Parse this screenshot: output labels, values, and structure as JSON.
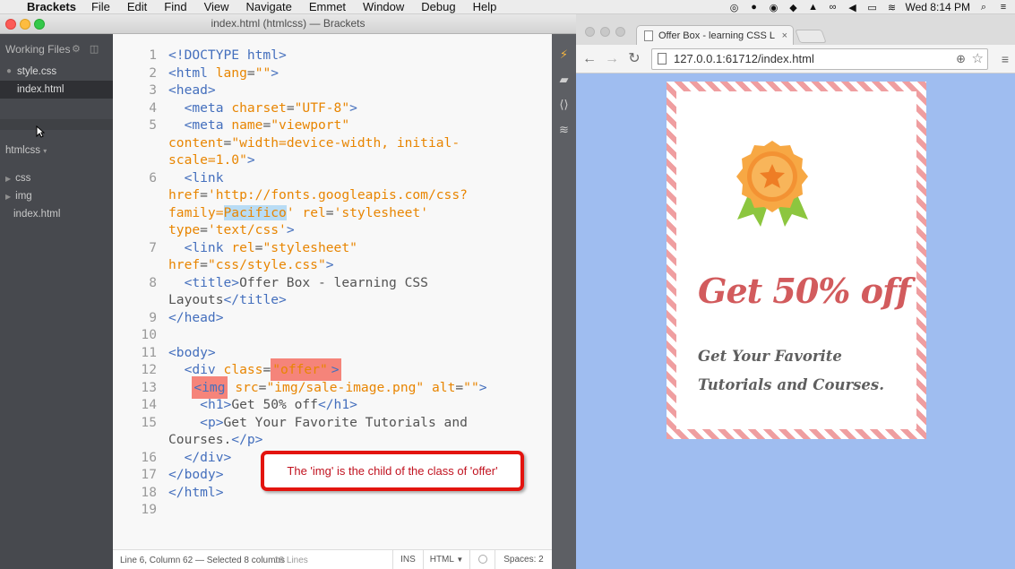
{
  "menubar": {
    "app": "Brackets",
    "items": [
      "File",
      "Edit",
      "Find",
      "View",
      "Navigate",
      "Emmet",
      "Window",
      "Debug",
      "Help"
    ],
    "clock": "Wed 8:14 PM"
  },
  "brackets": {
    "window_title": "index.html (htmlcss) — Brackets",
    "sidebar": {
      "working_files_label": "Working Files",
      "working_files": [
        "style.css",
        "index.html"
      ],
      "project_label": "htmlcss",
      "tree": [
        "css",
        "img",
        "index.html"
      ]
    },
    "code_lines": [
      {
        "n": "1",
        "html": "<span class='tag'>&lt;!DOCTYPE html&gt;</span>"
      },
      {
        "n": "2",
        "html": "<span class='tag'>&lt;html</span> <span class='attr'>lang</span>=<span class='str'>\"\"</span><span class='tag'>&gt;</span>"
      },
      {
        "n": "3",
        "html": "<span class='tag'>&lt;head&gt;</span>"
      },
      {
        "n": "4",
        "html": "  <span class='tag'>&lt;meta</span> <span class='attr'>charset</span>=<span class='str'>\"UTF-8\"</span><span class='tag'>&gt;</span>"
      },
      {
        "n": "5",
        "html": "  <span class='tag'>&lt;meta</span> <span class='attr'>name</span>=<span class='str'>\"viewport\"</span>"
      },
      {
        "n": "",
        "html": "<span class='attr'>content</span>=<span class='str'>\"width=device-width, initial-</span>"
      },
      {
        "n": "",
        "html": "<span class='str'>scale=1.0\"</span><span class='tag'>&gt;</span>"
      },
      {
        "n": "6",
        "html": "  <span class='tag'>&lt;link</span>"
      },
      {
        "n": "",
        "html": "<span class='attr'>href</span>=<span class='str'>'http://fonts.googleapis.com/css?</span>"
      },
      {
        "n": "",
        "html": "<span class='str'>family=<span class='hl-word'>Pacifico</span>'</span> <span class='attr'>rel</span>=<span class='str'>'stylesheet'</span>"
      },
      {
        "n": "",
        "html": "<span class='attr'>type</span>=<span class='str'>'text/css'</span><span class='tag'>&gt;</span>"
      },
      {
        "n": "7",
        "html": "  <span class='tag'>&lt;link</span> <span class='attr'>rel</span>=<span class='str'>\"stylesheet\"</span>"
      },
      {
        "n": "",
        "html": "<span class='attr'>href</span>=<span class='str'>\"css/style.css\"</span><span class='tag'>&gt;</span>"
      },
      {
        "n": "8",
        "html": "  <span class='tag'>&lt;title&gt;</span><span class='tx'>Offer Box - learning CSS</span>"
      },
      {
        "n": "",
        "html": "<span class='tx'>Layouts</span><span class='tag'>&lt;/title&gt;</span>"
      },
      {
        "n": "9",
        "html": "<span class='tag'>&lt;/head&gt;</span>"
      },
      {
        "n": "10",
        "html": ""
      },
      {
        "n": "11",
        "html": "<span class='tag'>&lt;body&gt;</span>"
      },
      {
        "n": "12",
        "html": "  <span class='tag'>&lt;div</span> <span class='attr'>class</span>=<span class='str hl-red2'>\"offer\"</span><span class='tag hl-red2'>&gt;</span>"
      },
      {
        "n": "13",
        "html": "   <span class='tag hl-red2'>&lt;img</span> <span class='attr'>src</span>=<span class='str'>\"img/sale-image.png\"</span> <span class='attr'>alt</span>=<span class='str'>\"\"</span><span class='tag'>&gt;</span>"
      },
      {
        "n": "14",
        "html": "    <span class='tag'>&lt;h1&gt;</span><span class='tx'>Get 50% off</span><span class='tag'>&lt;/h1&gt;</span>"
      },
      {
        "n": "15",
        "html": "    <span class='tag'>&lt;p&gt;</span><span class='tx'>Get Your Favorite Tutorials and</span>"
      },
      {
        "n": "",
        "html": "<span class='tx'>Courses.</span><span class='tag'>&lt;/p&gt;</span>"
      },
      {
        "n": "16",
        "html": "  <span class='tag'>&lt;/div&gt;</span>"
      },
      {
        "n": "17",
        "html": "<span class='tag'>&lt;/body&gt;</span>"
      },
      {
        "n": "18",
        "html": "<span class='tag'>&lt;/html&gt;</span>"
      },
      {
        "n": "19",
        "html": ""
      }
    ],
    "status": {
      "position": "Line 6, Column 62 — Selected 8 columns",
      "lines": "19 Lines",
      "mode": "INS",
      "language": "HTML",
      "spaces": "Spaces: 2"
    }
  },
  "annotation": "The 'img' is the child of the class of 'offer'",
  "chrome": {
    "tab_title": "Offer Box - learning CSS L",
    "url": "127.0.0.1:61712/index.html",
    "page": {
      "heading": "Get 50% off",
      "paragraph": "Get Your Favorite Tutorials and Courses."
    }
  }
}
